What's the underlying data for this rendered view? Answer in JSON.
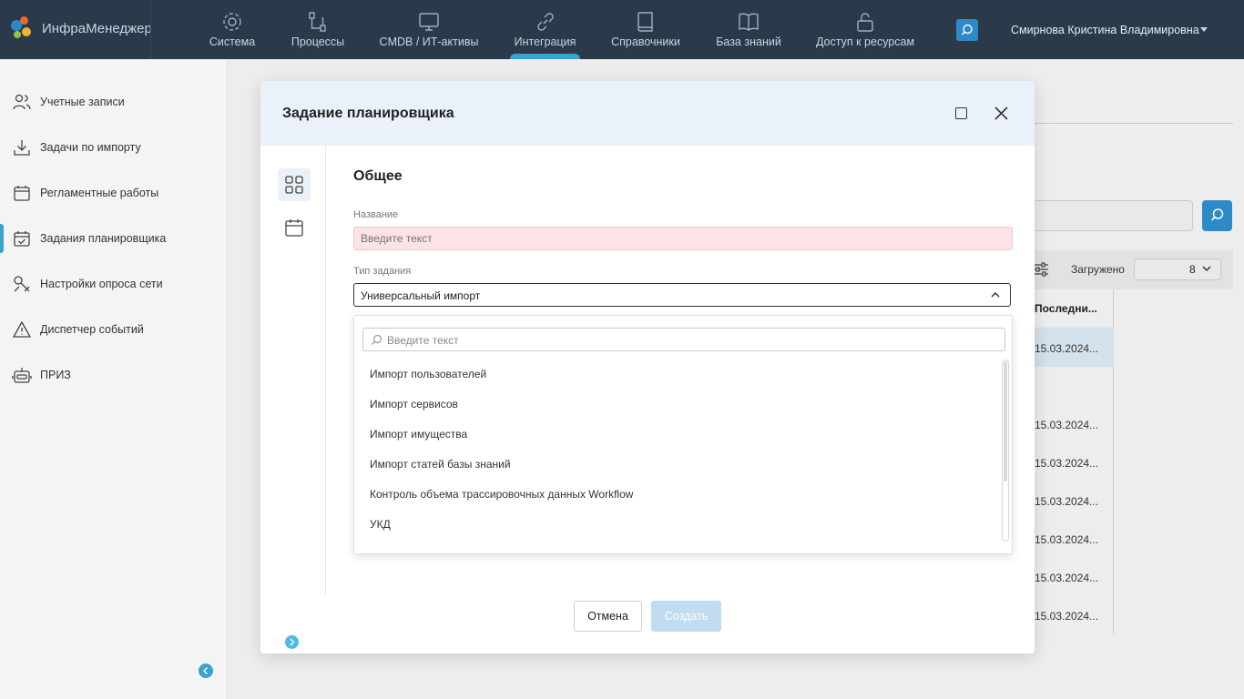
{
  "app": {
    "name": "ИнфраМенеджер"
  },
  "nav": [
    {
      "label": "Система",
      "icon": "gear-icon"
    },
    {
      "label": "Процессы",
      "icon": "process-icon"
    },
    {
      "label": "CMDB / ИТ-активы",
      "icon": "monitor-icon"
    },
    {
      "label": "Интеграция",
      "icon": "link-icon",
      "active": true
    },
    {
      "label": "Справочники",
      "icon": "book-icon"
    },
    {
      "label": "База знаний",
      "icon": "open-book-icon"
    },
    {
      "label": "Доступ к ресурсам",
      "icon": "unlock-icon"
    }
  ],
  "user": {
    "name": "Смирнова Кристина Владимировна"
  },
  "sidebar": {
    "items": [
      {
        "label": "Учетные записи",
        "icon": "users-icon"
      },
      {
        "label": "Задачи по импорту",
        "icon": "download-icon"
      },
      {
        "label": "Регламентные работы",
        "icon": "calendar-icon"
      },
      {
        "label": "Задания планировщика",
        "icon": "calendar-check-icon",
        "active": true
      },
      {
        "label": "Настройки опроса сети",
        "icon": "network-tools-icon"
      },
      {
        "label": "Диспетчер событий",
        "icon": "warning-icon"
      },
      {
        "label": "ПРИЗ",
        "icon": "robot-icon"
      }
    ]
  },
  "background": {
    "loaded_label": "Загружено",
    "page_size": "8",
    "column_header": "Последни...",
    "rows": [
      "15.03.2024...",
      "15.03.2024...",
      "15.03.2024...",
      "15.03.2024...",
      "15.03.2024...",
      "15.03.2024...",
      "15.03.2024..."
    ]
  },
  "modal": {
    "title": "Задание планировщика",
    "section_title": "Общее",
    "name_label": "Название",
    "name_placeholder": "Введите текст",
    "type_label": "Тип задания",
    "type_value": "Универсальный импорт",
    "dropdown": {
      "search_placeholder": "Введите текст",
      "options": [
        "Импорт пользователей",
        "Импорт сервисов",
        "Импорт имущества",
        "Импорт статей базы знаний",
        "Контроль объема трассировочных данных Workflow",
        "УКД"
      ]
    },
    "cancel_label": "Отмена",
    "create_label": "Создать"
  },
  "colors": {
    "topbar": "#2b3a4b",
    "accent": "#3aa3c9",
    "primary": "#2e8ac7",
    "required_bg": "#fbe3e6",
    "disabled_btn": "#bfdcf1"
  }
}
